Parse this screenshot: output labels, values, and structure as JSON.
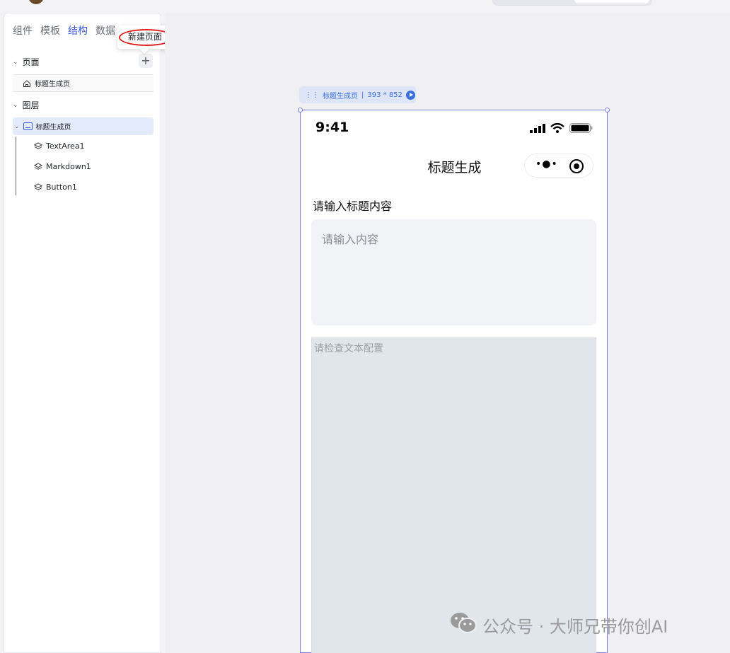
{
  "sidebar": {
    "tabs": [
      "组件",
      "模板",
      "结构",
      "数据"
    ],
    "active_tab": "结构",
    "tooltip": "新建页面",
    "add_symbol": "+",
    "pages_section": "页面",
    "page_item": "标题生成页",
    "layers_section": "图层",
    "layer_root": "标题生成页",
    "layer_children": [
      "TextArea1",
      "Markdown1",
      "Button1"
    ]
  },
  "canvas": {
    "frame_label": "标题生成页",
    "frame_size": "393 * 852"
  },
  "phone": {
    "time": "9:41",
    "nav_title": "标题生成",
    "form_label": "请输入标题内容",
    "textarea_placeholder": "请输入内容",
    "markdown_placeholder": "请检查文本配置"
  },
  "watermark": "公众号 · 大师兄带你创AI",
  "colors": {
    "accent": "#3b5bdb",
    "frame_border": "#7b83e8",
    "highlight_circle": "#e02020"
  }
}
